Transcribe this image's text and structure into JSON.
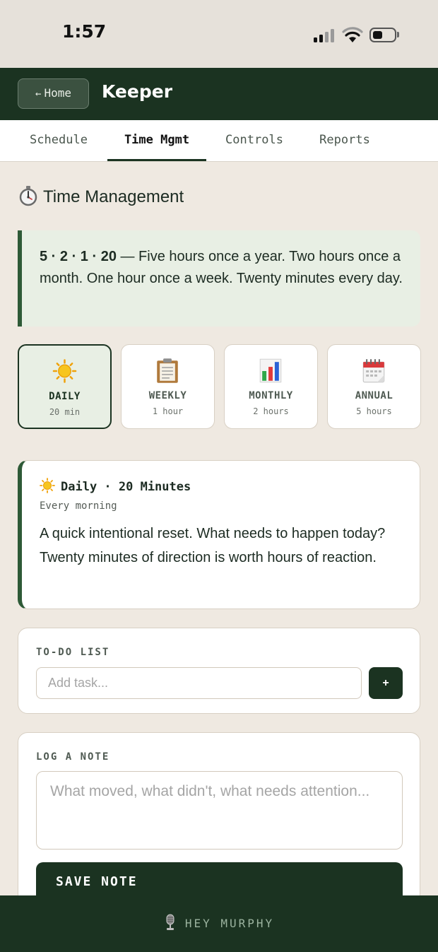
{
  "status_bar": {
    "time": "1:57"
  },
  "header": {
    "back_label": "Home",
    "back_arrow": "←",
    "title": "Keeper"
  },
  "tabs": [
    {
      "label": "Schedule",
      "active": false
    },
    {
      "label": "Time Mgmt",
      "active": true
    },
    {
      "label": "Controls",
      "active": false
    },
    {
      "label": "Reports",
      "active": false
    }
  ],
  "section": {
    "title": "Time Management",
    "icon": "stopwatch-icon"
  },
  "quote": {
    "bold": "5 · 2 · 1 · 20",
    "text": " — Five hours once a year. Two hours once a month. One hour once a week. Twenty minutes every day."
  },
  "periods": [
    {
      "name": "DAILY",
      "duration": "20 min",
      "icon": "sun-icon",
      "active": true
    },
    {
      "name": "WEEKLY",
      "duration": "1 hour",
      "icon": "clipboard-icon",
      "active": false
    },
    {
      "name": "MONTHLY",
      "duration": "2 hours",
      "icon": "bar-chart-icon",
      "active": false
    },
    {
      "name": "ANNUAL",
      "duration": "5 hours",
      "icon": "calendar-icon",
      "active": false
    }
  ],
  "detail": {
    "title": "Daily · 20 Minutes",
    "subtitle": "Every morning",
    "body": "A quick intentional reset. What needs to happen today? Twenty minutes of direction is worth hours of reaction."
  },
  "todo": {
    "label": "TO-DO LIST",
    "placeholder": "Add task...",
    "add_label": "+"
  },
  "note": {
    "label": "LOG A NOTE",
    "placeholder": "What moved, what didn't, what needs attention...",
    "save_label": "SAVE NOTE"
  },
  "bottom": {
    "label": "HEY MURPHY",
    "icon": "microphone-icon"
  },
  "colors": {
    "brand": "#1b3321",
    "accent": "#2e5a37",
    "background": "#efe9e1",
    "highlight": "#e8efe4"
  }
}
